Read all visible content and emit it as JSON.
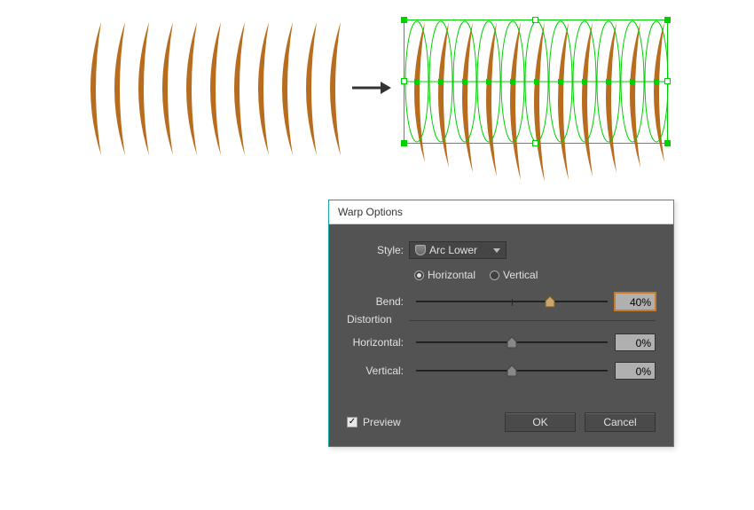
{
  "canvas": {
    "arc_color": "#b86c1e",
    "arc_count": 11,
    "selection_color": "#00d000"
  },
  "dialog": {
    "title": "Warp Options",
    "style": {
      "label": "Style:",
      "value": "Arc Lower"
    },
    "orientation": {
      "horizontal": "Horizontal",
      "vertical": "Vertical",
      "selected": "horizontal"
    },
    "bend": {
      "label": "Bend:",
      "value": "40%",
      "position": 70
    },
    "distortion": {
      "legend": "Distortion",
      "horizontal": {
        "label": "Horizontal:",
        "value": "0%",
        "position": 50
      },
      "vertical": {
        "label": "Vertical:",
        "value": "0%",
        "position": 50
      }
    },
    "preview": {
      "label": "Preview",
      "checked": true
    },
    "buttons": {
      "ok": "OK",
      "cancel": "Cancel"
    }
  }
}
